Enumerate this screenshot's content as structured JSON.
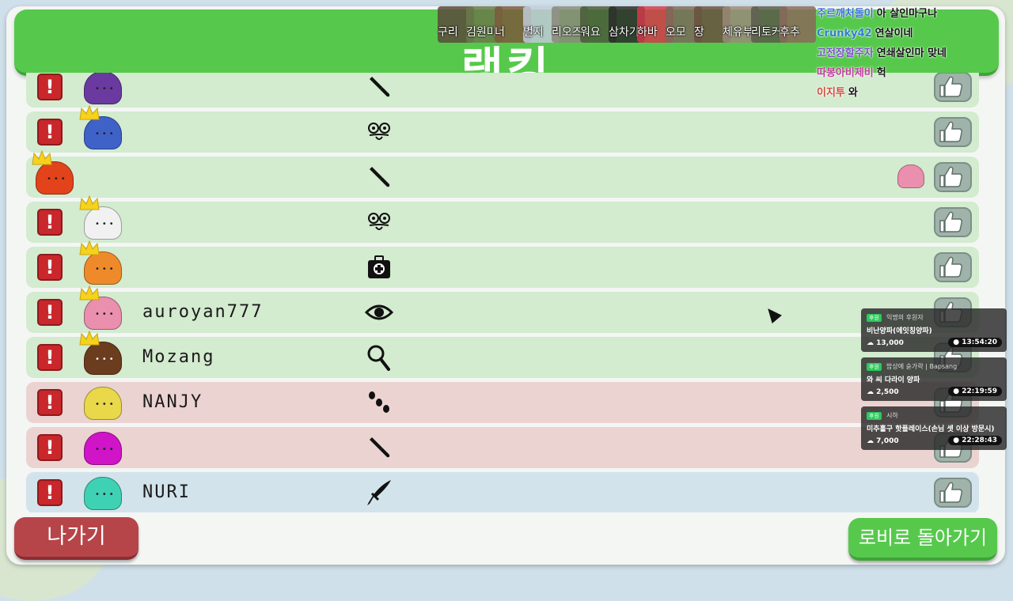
{
  "title": "랭킹",
  "colors": {
    "header_green": "#56c94c",
    "exit_red": "#b6454a",
    "row_green": "#d3ebcf",
    "row_red": "#ebd3d1",
    "row_blue": "#d2e3ec"
  },
  "players": [
    {
      "name": "",
      "team": "green",
      "avatar_color": "#6a3aa0",
      "crown": false,
      "role_icon": "knife-icon"
    },
    {
      "name": "",
      "team": "green",
      "avatar_color": "#3f62c9",
      "crown": true,
      "role_icon": "mask-icon"
    },
    {
      "name": "",
      "team": "green",
      "avatar_color": "#e2431b",
      "crown": true,
      "role_icon": "knife-icon"
    },
    {
      "name": "",
      "team": "green",
      "avatar_color": "#f1f1f1",
      "crown": true,
      "role_icon": "mask-icon"
    },
    {
      "name": "",
      "team": "green",
      "avatar_color": "#ef8a2b",
      "crown": true,
      "role_icon": "medkit-icon"
    },
    {
      "name": "auroyan777",
      "team": "green",
      "avatar_color": "#ea8fae",
      "crown": true,
      "role_icon": "eye-icon"
    },
    {
      "name": "Mozang",
      "team": "green",
      "avatar_color": "#6b3c1e",
      "crown": true,
      "role_icon": "magnifier-icon"
    },
    {
      "name": "NANJY",
      "team": "red",
      "avatar_color": "#e8d84a",
      "crown": false,
      "role_icon": "footprints-icon"
    },
    {
      "name": "",
      "team": "red",
      "avatar_color": "#d014c7",
      "crown": false,
      "role_icon": "knife-icon"
    },
    {
      "name": "NURI",
      "team": "blue",
      "avatar_color": "#3fd1b4",
      "crown": false,
      "role_icon": "dagger-icon"
    }
  ],
  "buttons": {
    "exit": "나가기",
    "lobby": "로비로 돌아가기"
  },
  "stream_viewers": [
    {
      "name": "구리"
    },
    {
      "name": "김원미"
    },
    {
      "name": "너"
    },
    {
      "name": "별지"
    },
    {
      "name": "리오즈"
    },
    {
      "name": "워요"
    },
    {
      "name": "삼차기"
    },
    {
      "name": "하바"
    },
    {
      "name": "오모"
    },
    {
      "name": "장"
    },
    {
      "name": "체유부"
    },
    {
      "name": "리토커"
    },
    {
      "name": "후추"
    }
  ],
  "chat": [
    {
      "user": "주르깨처돌이",
      "msg": "아 살인마구나",
      "color": "#3a6fd8"
    },
    {
      "user": "Crunky42",
      "msg": "연살이네",
      "color": "#2f7fd0"
    },
    {
      "user": "고전장할주자",
      "msg": "연쇄살인마 맞네",
      "color": "#7b4fc9"
    },
    {
      "user": "따봉아비제비",
      "msg": "헉",
      "color": "#c23a9e"
    },
    {
      "user": "이지투",
      "msg": "와",
      "color": "#d24a3a"
    }
  ],
  "donations": [
    {
      "tag": "후원",
      "who": "익명의 후원자",
      "msg": "비난양파(에잇칭양파)",
      "amount": "13,000",
      "time": "13:54:20"
    },
    {
      "tag": "후원",
      "who": "밥상에 숟가락 | Bapsang",
      "msg": "와 씨 다라이 양파",
      "amount": "2,500",
      "time": "22:19:59"
    },
    {
      "tag": "후원",
      "who": "시하",
      "msg": "미추홀구 핫플레이스(손님 셋 이상 방문시)",
      "amount": "7,000",
      "time": "22:28:43"
    }
  ]
}
